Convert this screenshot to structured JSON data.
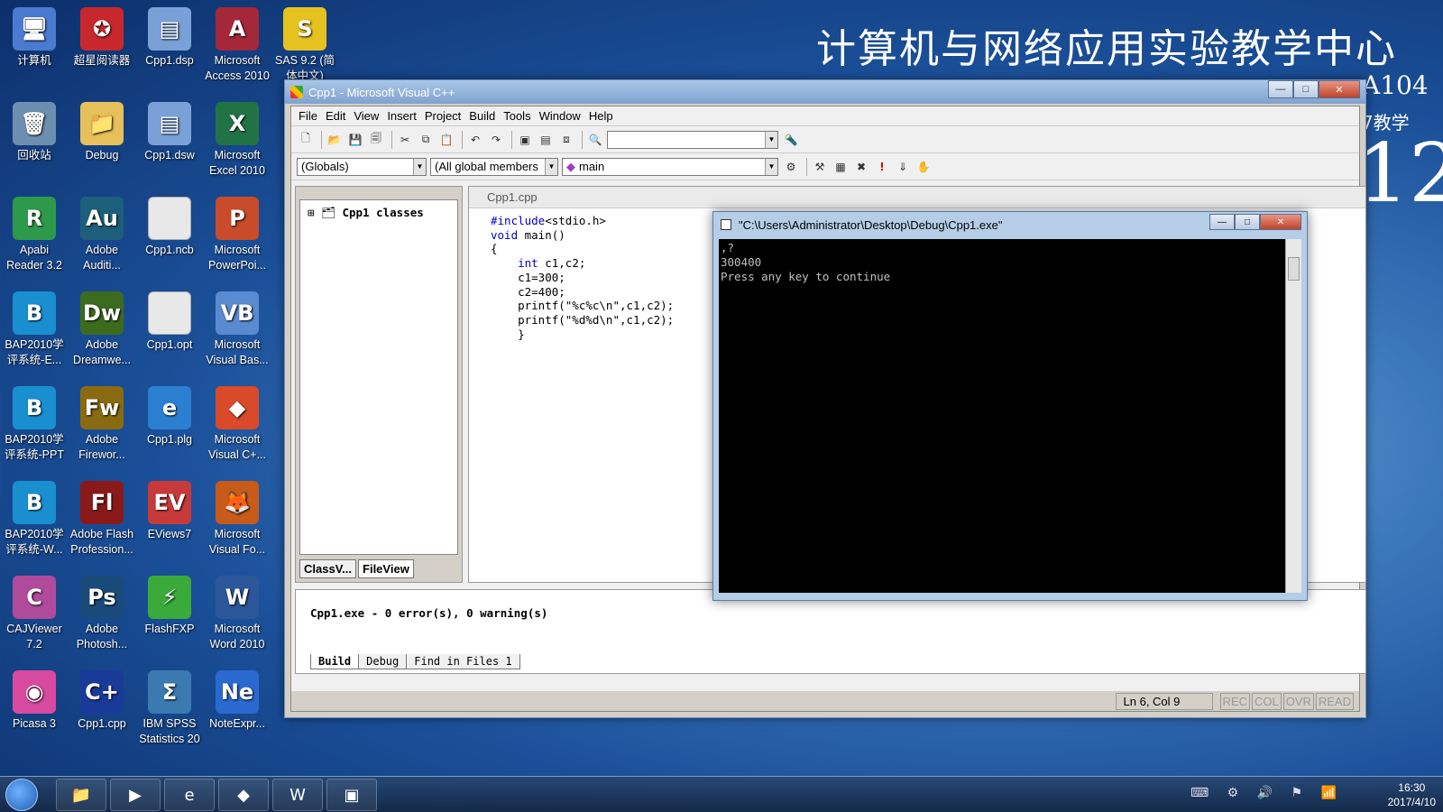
{
  "wallpaper": {
    "title": "计算机与网络应用实验教学中心",
    "room": "A104",
    "sub": "N7教学",
    "big": "12"
  },
  "desktop_icons": [
    {
      "label": "计算机",
      "icon": "computer-icon",
      "color": "#4a7bd0"
    },
    {
      "label": "超星阅读器",
      "icon": "reader-icon",
      "color": "#c8282d"
    },
    {
      "label": "Cpp1.dsp",
      "icon": "project-file-icon",
      "color": "#7aa0d8"
    },
    {
      "label": "Microsoft Access 2010",
      "icon": "access-icon",
      "color": "#a4273a"
    },
    {
      "label": "SAS 9.2 (简体中文)",
      "icon": "sas-icon",
      "color": "#e6c220"
    },
    {
      "label": "回收站",
      "icon": "recycle-bin-icon",
      "color": "#6c8fb0"
    },
    {
      "label": "Debug",
      "icon": "folder-icon",
      "color": "#e6c05a"
    },
    {
      "label": "Cpp1.dsw",
      "icon": "workspace-file-icon",
      "color": "#7aa0d8"
    },
    {
      "label": "Microsoft Excel 2010",
      "icon": "excel-icon",
      "color": "#217346"
    },
    {
      "label": "Apabi Reader 3.2",
      "icon": "apabi-icon",
      "color": "#2c9a4a"
    },
    {
      "label": "Adobe Auditi...",
      "icon": "audition-icon",
      "color": "#1d5f7a"
    },
    {
      "label": "Cpp1.ncb",
      "icon": "file-icon",
      "color": "#e8e8e8"
    },
    {
      "label": "Microsoft PowerPoi...",
      "icon": "powerpoint-icon",
      "color": "#c84b2a"
    },
    {
      "label": "BAP2010学评系统-E...",
      "icon": "bap-icon",
      "color": "#1a8fd0"
    },
    {
      "label": "Adobe Dreamwe...",
      "icon": "dreamweaver-icon",
      "color": "#3d6b1e"
    },
    {
      "label": "Cpp1.opt",
      "icon": "file-icon",
      "color": "#e8e8e8"
    },
    {
      "label": "Microsoft Visual Bas...",
      "icon": "visual-basic-icon",
      "color": "#5a8ad0"
    },
    {
      "label": "BAP2010学评系统-PPT",
      "icon": "bap-icon",
      "color": "#1a8fd0"
    },
    {
      "label": "Adobe Firewor...",
      "icon": "fireworks-icon",
      "color": "#8a6a10"
    },
    {
      "label": "Cpp1.plg",
      "icon": "ie-icon",
      "color": "#2a7fd0"
    },
    {
      "label": "Microsoft Visual C+...",
      "icon": "visual-cpp-icon",
      "color": "#d84a2a"
    },
    {
      "label": "BAP2010学评系统-W...",
      "icon": "bap-icon",
      "color": "#1a8fd0"
    },
    {
      "label": "Adobe Flash Profession...",
      "icon": "flash-icon",
      "color": "#8a1a1a"
    },
    {
      "label": "EViews7",
      "icon": "eviews-icon",
      "color": "#c83a3a"
    },
    {
      "label": "Microsoft Visual Fo...",
      "icon": "visual-foxpro-icon",
      "color": "#c85a1a"
    },
    {
      "label": "CAJViewer 7.2",
      "icon": "cajviewer-icon",
      "color": "#b04a9a"
    },
    {
      "label": "Adobe Photosh...",
      "icon": "photoshop-icon",
      "color": "#1a4a7a"
    },
    {
      "label": "FlashFXP",
      "icon": "flashfxp-icon",
      "color": "#3aaa3a"
    },
    {
      "label": "Microsoft Word 2010",
      "icon": "word-icon",
      "color": "#2b579a"
    },
    {
      "label": "Picasa 3",
      "icon": "picasa-icon",
      "color": "#d84aa0"
    },
    {
      "label": "Cpp1.cpp",
      "icon": "cpp-file-icon",
      "color": "#1a3a9a"
    },
    {
      "label": "IBM SPSS Statistics 20",
      "icon": "spss-icon",
      "color": "#3a7ab0"
    },
    {
      "label": "NoteExpr...",
      "icon": "noteexpress-icon",
      "color": "#2a6ad0"
    }
  ],
  "vc": {
    "title": "Cpp1 - Microsoft Visual C++",
    "menu": [
      "File",
      "Edit",
      "View",
      "Insert",
      "Project",
      "Build",
      "Tools",
      "Window",
      "Help"
    ],
    "combo_find": "",
    "combo_globals": "(Globals)",
    "combo_members": "(All global members",
    "combo_main": "main",
    "workspace": {
      "tree_root": "Cpp1 classes",
      "tab_class": "ClassV...",
      "tab_file": "FileView"
    },
    "editor": {
      "filename": "Cpp1.cpp",
      "lines": [
        {
          "kw": "#include",
          "rest": "<stdio.h>"
        },
        {
          "kw": "void",
          "rest": " main()"
        },
        {
          "kw": "",
          "rest": "{"
        },
        {
          "kw": "    int",
          "rest": " c1,c2;"
        },
        {
          "kw": "",
          "rest": "    c1=300;"
        },
        {
          "kw": "",
          "rest": "    c2=400;"
        },
        {
          "kw": "",
          "rest": "    printf(\"%c%c\\n\",c1,c2);"
        },
        {
          "kw": "",
          "rest": "    printf(\"%d%d\\n\",c1,c2);"
        },
        {
          "kw": "",
          "rest": "    }"
        }
      ]
    },
    "output": {
      "text": "Cpp1.exe - 0 error(s), 0 warning(s)",
      "tabs": [
        "Build",
        "Debug",
        "Find in Files 1"
      ]
    },
    "status": {
      "position": "Ln 6, Col 9",
      "indicators": [
        "REC",
        "COL",
        "OVR",
        "READ"
      ]
    }
  },
  "console": {
    "title": "\"C:\\Users\\Administrator\\Desktop\\Debug\\Cpp1.exe\"",
    "lines": [
      ",?",
      "300400",
      "Press any key to continue"
    ]
  },
  "taskbar": {
    "time": "16:30",
    "date": "2017/4/10"
  }
}
